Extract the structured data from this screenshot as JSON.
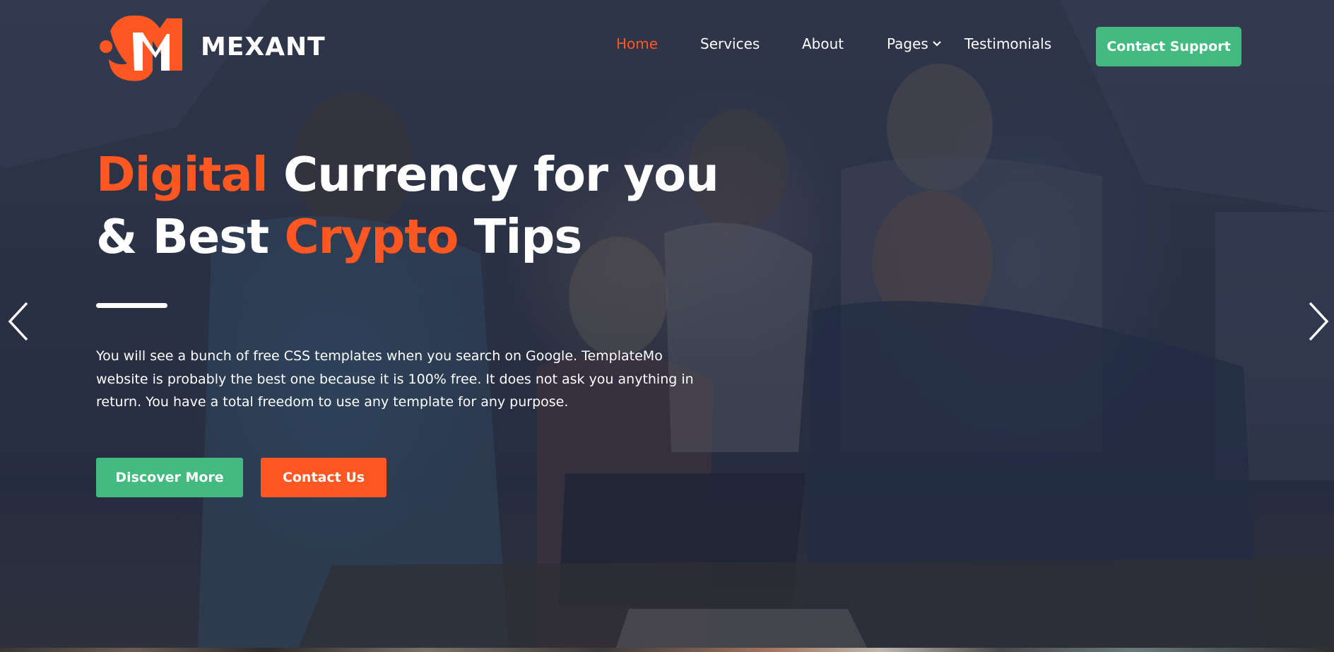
{
  "brand": {
    "name": "MEXANT",
    "accent_color": "#ff5722",
    "logo_icon": "mexant-logo-icon"
  },
  "nav": {
    "items": [
      {
        "label": "Home",
        "active": true
      },
      {
        "label": "Services",
        "active": false
      },
      {
        "label": "About",
        "active": false
      },
      {
        "label": "Pages",
        "active": false,
        "has_dropdown": true
      },
      {
        "label": "Testimonials",
        "active": false
      }
    ],
    "cta_label": "Contact Support",
    "cta_color": "#43ba7f"
  },
  "hero": {
    "line1_accent": "Digital",
    "line1_rest": "Currency for you",
    "line2_start": "& Best",
    "line2_accent": "Crypto",
    "line2_end": "Tips",
    "description": "You will see a bunch of free CSS templates when you search on Google. TemplateMo website is probably the best one because it is 100% free. It does not ask you anything in return. You have a total freedom to use any template for any purpose.",
    "buttons": {
      "discover": "Discover More",
      "contact": "Contact Us"
    },
    "colors": {
      "primary_green": "#43ba7f",
      "primary_orange": "#ff5722",
      "text": "#ffffff"
    }
  },
  "carousel": {
    "prev_icon": "chevron-left-icon",
    "next_icon": "chevron-right-icon"
  }
}
